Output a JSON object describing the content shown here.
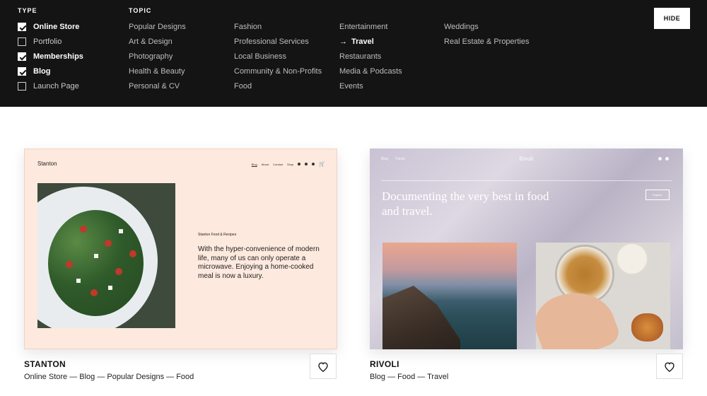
{
  "filter": {
    "type_title": "TYPE",
    "topic_title": "TOPIC",
    "types": [
      {
        "label": "Online Store",
        "checked": true
      },
      {
        "label": "Portfolio",
        "checked": false
      },
      {
        "label": "Memberships",
        "checked": true
      },
      {
        "label": "Blog",
        "checked": true
      },
      {
        "label": "Launch Page",
        "checked": false
      }
    ],
    "topic_columns": [
      [
        "Popular Designs",
        "Art & Design",
        "Photography",
        "Health & Beauty",
        "Personal & CV"
      ],
      [
        "Fashion",
        "Professional Services",
        "Local Business",
        "Community & Non-Profits",
        "Food"
      ],
      [
        "Entertainment",
        "Travel",
        "Restaurants",
        "Media & Podcasts",
        "Events"
      ],
      [
        "Weddings",
        "Real Estate & Properties"
      ]
    ],
    "active_topic": "Travel",
    "hide_label": "HIDE"
  },
  "cards": [
    {
      "name": "STANTON",
      "tags": "Online Store — Blog — Popular Designs — Food",
      "preview": {
        "logo": "Stanton",
        "nav": [
          "Blog",
          "About",
          "Contact",
          "Shop"
        ],
        "kicker": "Stanton Food & Recipes",
        "quote": "With the hyper-convenience of modern life, many of us can only operate a microwave. Enjoying a home-cooked meal is now a luxury."
      }
    },
    {
      "name": "RIVOLI",
      "tags": "Blog — Food — Travel",
      "preview": {
        "logo": "Rivoli",
        "nav": [
          "Blog",
          "Travel"
        ],
        "headline": "Documenting the very best in food and travel.",
        "button": "Explore"
      }
    }
  ]
}
